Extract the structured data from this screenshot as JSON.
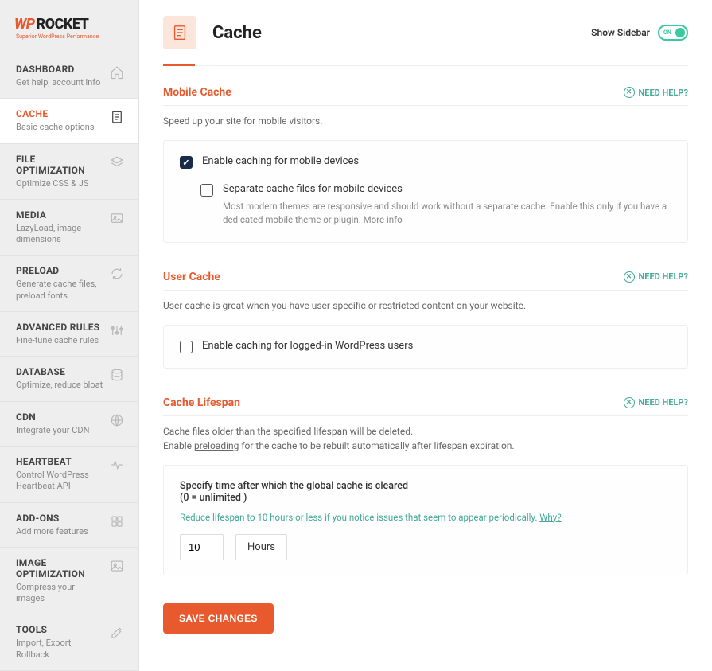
{
  "logo": {
    "part1": "WP",
    "part2": "ROCKET",
    "sub": "Superior WordPress Performance"
  },
  "nav": [
    {
      "title": "DASHBOARD",
      "sub": "Get help, account info",
      "icon": "home",
      "active": false
    },
    {
      "title": "CACHE",
      "sub": "Basic cache options",
      "icon": "doc",
      "active": true
    },
    {
      "title": "FILE OPTIMIZATION",
      "sub": "Optimize CSS & JS",
      "icon": "layers",
      "active": false
    },
    {
      "title": "MEDIA",
      "sub": "LazyLoad, image dimensions",
      "icon": "media",
      "active": false
    },
    {
      "title": "PRELOAD",
      "sub": "Generate cache files, preload fonts",
      "icon": "refresh",
      "active": false
    },
    {
      "title": "ADVANCED RULES",
      "sub": "Fine-tune cache rules",
      "icon": "sliders",
      "active": false
    },
    {
      "title": "DATABASE",
      "sub": "Optimize, reduce bloat",
      "icon": "database",
      "active": false
    },
    {
      "title": "CDN",
      "sub": "Integrate your CDN",
      "icon": "cdn",
      "active": false
    },
    {
      "title": "HEARTBEAT",
      "sub": "Control WordPress Heartbeat API",
      "icon": "heartbeat",
      "active": false
    },
    {
      "title": "ADD-ONS",
      "sub": "Add more features",
      "icon": "addons",
      "active": false
    },
    {
      "title": "IMAGE OPTIMIZATION",
      "sub": "Compress your images",
      "icon": "image",
      "active": false
    },
    {
      "title": "TOOLS",
      "sub": "Import, Export, Rollback",
      "icon": "tools",
      "active": false
    }
  ],
  "page": {
    "title": "Cache",
    "show_sidebar": "Show Sidebar",
    "toggle_on": "ON"
  },
  "help": "NEED HELP?",
  "mobile": {
    "title": "Mobile Cache",
    "desc": "Speed up your site for mobile visitors.",
    "cb1": "Enable caching for mobile devices",
    "cb1_checked": true,
    "cb2": "Separate cache files for mobile devices",
    "cb2_checked": false,
    "cb2_desc": "Most modern themes are responsive and should work without a separate cache. Enable this only if you have a dedicated mobile theme or plugin. ",
    "more": "More info"
  },
  "user": {
    "title": "User Cache",
    "desc_link": "User cache",
    "desc_rest": " is great when you have user-specific or restricted content on your website.",
    "cb": "Enable caching for logged-in WordPress users",
    "cb_checked": false
  },
  "lifespan": {
    "title": "Cache Lifespan",
    "desc1": "Cache files older than the specified lifespan will be deleted.",
    "desc2a": "Enable ",
    "desc2_link": "preloading",
    "desc2b": " for the cache to be rebuilt automatically after lifespan expiration.",
    "spec": "Specify time after which the global cache is cleared",
    "spec2": "(0 = unlimited )",
    "tip": "Reduce lifespan to 10 hours or less if you notice issues that seem to appear periodically. ",
    "why": "Why?",
    "value": "10",
    "unit": "Hours"
  },
  "save": "SAVE CHANGES"
}
